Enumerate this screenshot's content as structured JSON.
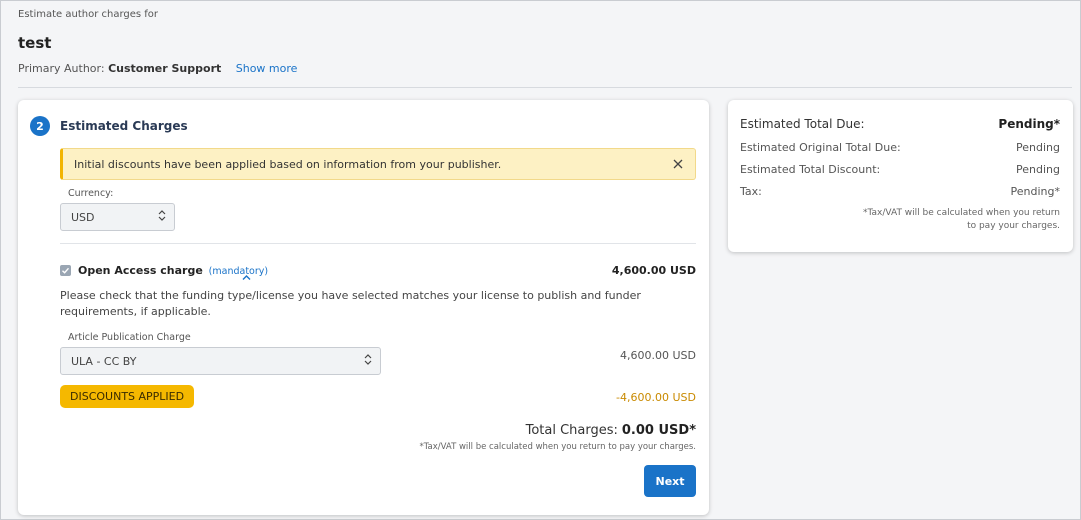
{
  "header": {
    "eyebrow": "Estimate author charges for",
    "title": "test",
    "author_prefix": "Primary Author:",
    "author_name": "Customer Support",
    "show_more": "Show more"
  },
  "charges": {
    "step_number": "2",
    "title": "Estimated Charges",
    "alert_text": "Initial discounts have been applied based on information from your publisher.",
    "currency_label": "Currency:",
    "currency_value": "USD",
    "open_access": {
      "label": "Open Access charge",
      "mandatory": "(mandatory)",
      "amount": "4,600.00 USD",
      "checked": true
    },
    "note": "Please check that the funding type/license you have selected matches your license to publish and funder requirements, if applicable.",
    "apc_label": "Article Publication Charge",
    "apc_value": "ULA - CC BY",
    "apc_amount": "4,600.00 USD",
    "discount_badge": "DISCOUNTS APPLIED",
    "discount_amount": "-4,600.00 USD",
    "total_label": "Total Charges:",
    "total_value": "0.00 USD*",
    "tax_note": "*Tax/VAT will be calculated when you return to pay your charges.",
    "next_label": "Next"
  },
  "summary": {
    "total_due_label": "Estimated Total Due:",
    "total_due_value": "Pending*",
    "original_label": "Estimated Original Total Due:",
    "original_value": "Pending",
    "discount_label": "Estimated Total Discount:",
    "discount_value": "Pending",
    "tax_label": "Tax:",
    "tax_value": "Pending*",
    "note": "*Tax/VAT will be calculated when you return to pay your charges."
  },
  "colors": {
    "primary": "#1a73c8",
    "alert_bg": "#fdf1c4",
    "badge": "#f5b800",
    "discount_text": "#c98a00"
  }
}
